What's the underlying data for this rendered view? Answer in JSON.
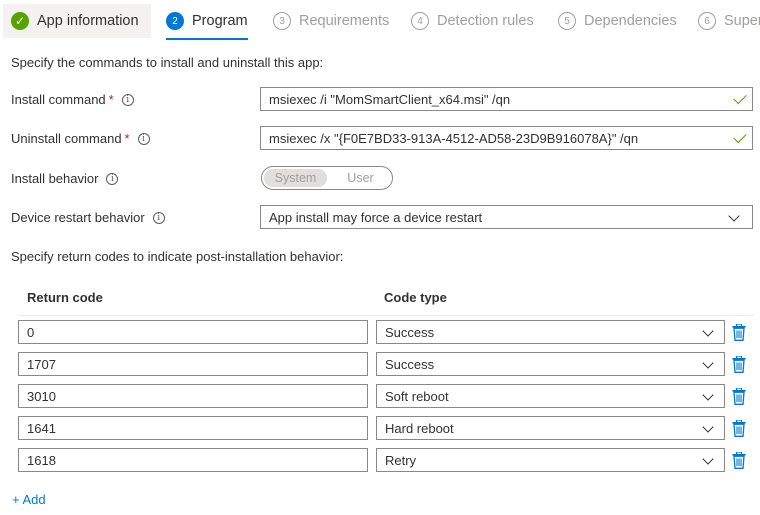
{
  "steps": [
    {
      "num": "✓",
      "label": "App information",
      "state": "done"
    },
    {
      "num": "2",
      "label": "Program",
      "state": "current"
    },
    {
      "num": "3",
      "label": "Requirements",
      "state": "disabled"
    },
    {
      "num": "4",
      "label": "Detection rules",
      "state": "disabled"
    },
    {
      "num": "5",
      "label": "Dependencies",
      "state": "disabled"
    },
    {
      "num": "6",
      "label": "Super",
      "state": "disabled"
    }
  ],
  "form": {
    "intro": "Specify the commands to install and uninstall this app:",
    "install_label": "Install command",
    "install_value": "msiexec /i \"MomSmartClient_x64.msi\" /qn",
    "uninstall_label": "Uninstall command",
    "uninstall_value": "msiexec /x \"{F0E7BD33-913A-4512-AD58-23D9B916078A}\" /qn",
    "behavior_label": "Install behavior",
    "behavior_options": [
      "System",
      "User"
    ],
    "behavior_selected": "System",
    "restart_label": "Device restart behavior",
    "restart_value": "App install may force a device restart",
    "required_mark": "*",
    "info_glyph": "i"
  },
  "return_codes": {
    "intro": "Specify return codes to indicate post-installation behavior:",
    "col_code": "Return code",
    "col_type": "Code type",
    "rows": [
      {
        "code": "0",
        "type": "Success"
      },
      {
        "code": "1707",
        "type": "Success"
      },
      {
        "code": "3010",
        "type": "Soft reboot"
      },
      {
        "code": "1641",
        "type": "Hard reboot"
      },
      {
        "code": "1618",
        "type": "Retry"
      }
    ],
    "add_label": "+ Add"
  },
  "colors": {
    "accent": "#0078d4",
    "success": "#57a300",
    "required": "#a4262c",
    "disabled": "#a19f9d"
  },
  "icons": {
    "valid": "checkmark-icon",
    "info": "info-icon",
    "dropdown": "chevron-down-icon",
    "delete": "trash-icon"
  }
}
